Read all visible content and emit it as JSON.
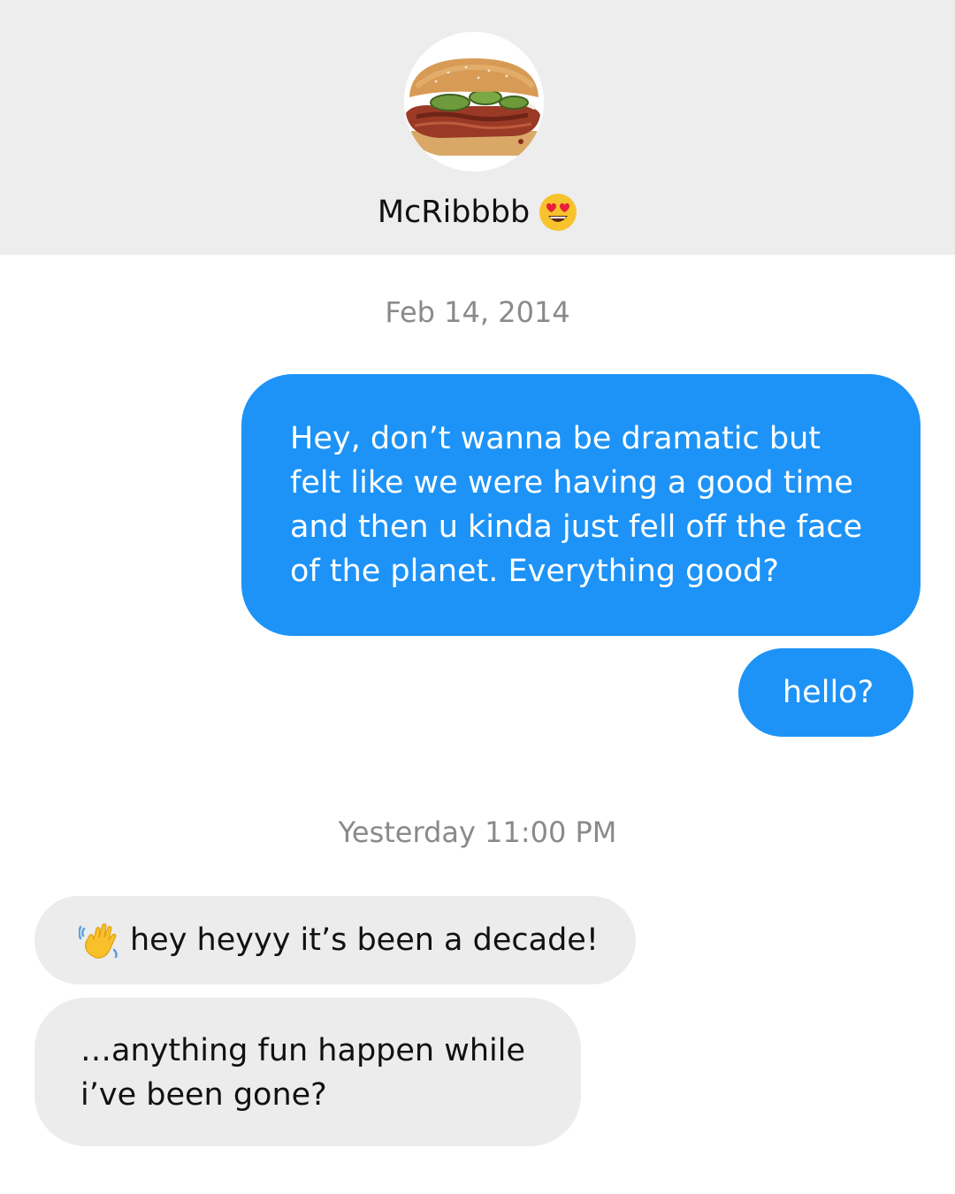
{
  "contact": {
    "name": "McRibbbb",
    "name_emoji": "heart-eyes-emoji"
  },
  "conversation": {
    "first_timestamp": "Feb 14, 2014",
    "second_timestamp": "Yesterday 11:00 PM",
    "messages": [
      {
        "direction": "sent",
        "lines": [
          "Hey, don’t wanna be dramatic but",
          "felt like we were having a good time",
          "and then u kinda just fell off the face",
          "of the planet. Everything good?"
        ]
      },
      {
        "direction": "sent",
        "lines": [
          "hello?"
        ]
      },
      {
        "direction": "received",
        "emoji": "waving-hand-emoji",
        "lines": [
          "hey heyyy it’s been a decade!"
        ]
      },
      {
        "direction": "received",
        "lines": [
          "…anything fun happen while",
          "i’ve been gone?"
        ]
      }
    ]
  },
  "colors": {
    "header_bg": "#ededed",
    "sent_bubble": "#1d93f7",
    "received_bubble": "#ececec",
    "timestamp_text": "#8a8a8a"
  }
}
